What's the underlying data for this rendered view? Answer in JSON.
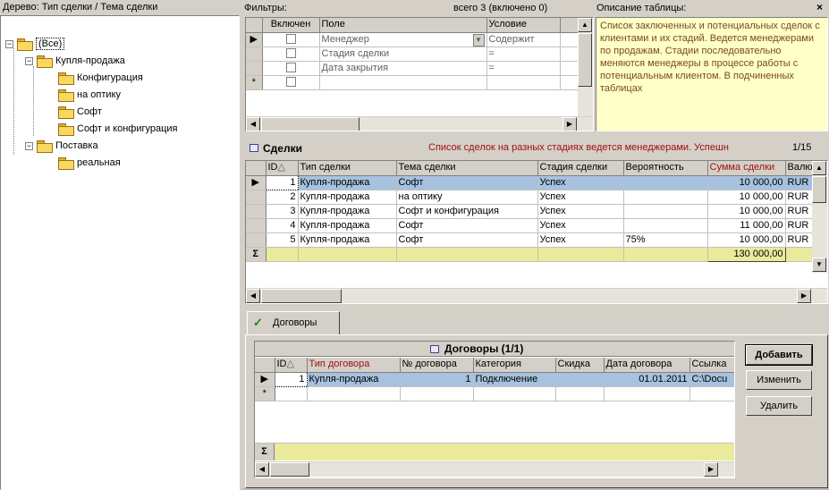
{
  "tree": {
    "title": "Дерево: Тип сделки / Тема сделки",
    "nodes": [
      {
        "label": "(Все)",
        "expander": "−"
      },
      {
        "label": "Купля-продажа",
        "expander": "−"
      },
      {
        "label": "Конфигурация"
      },
      {
        "label": "на оптику"
      },
      {
        "label": "Софт"
      },
      {
        "label": "Софт и конфигурация"
      },
      {
        "label": "Поставка",
        "expander": "−"
      },
      {
        "label": "реальная"
      }
    ]
  },
  "filters": {
    "title": "Фильтры:",
    "count": "всего 3 (включено 0)",
    "columns": [
      "Включен",
      "Поле",
      "Условие"
    ],
    "rows": [
      {
        "field": "Менеджер",
        "condition": "Содержит"
      },
      {
        "field": "Стадия сделки",
        "condition": "="
      },
      {
        "field": "Дата закрытия",
        "condition": "="
      }
    ],
    "new_row_marker": "*"
  },
  "description": {
    "title": "Описание таблицы:",
    "close": "×",
    "text": "Список заключенных и потенциальных сделок с клиентами и их стадий. Ведется менеджерами по продажам. Стадии последовательно меняются менеджеры в процессе работы с потенциальным клиентом. В подчиненных таблицах"
  },
  "deals": {
    "title": "Сделки",
    "banner": "Список сделок на разных стадиях ведется менеджерами. Успешн",
    "page": "1/15",
    "columns": [
      "ID",
      "Тип сделки",
      "Тема сделки",
      "Стадия сделки",
      "Вероятность",
      "Сумма сделки",
      "Валю"
    ],
    "sort_mark": "△",
    "rows": [
      {
        "id": "1",
        "type": "Купля-продажа",
        "topic": "Софт",
        "stage": "Успех",
        "prob": "",
        "sum": "10 000,00",
        "cur": "RUR"
      },
      {
        "id": "2",
        "type": "Купля-продажа",
        "topic": "на оптику",
        "stage": "Успех",
        "prob": "",
        "sum": "10 000,00",
        "cur": "RUR"
      },
      {
        "id": "3",
        "type": "Купля-продажа",
        "topic": "Софт и конфигурация",
        "stage": "Успех",
        "prob": "",
        "sum": "10 000,00",
        "cur": "RUR"
      },
      {
        "id": "4",
        "type": "Купля-продажа",
        "topic": "Софт",
        "stage": "Успех",
        "prob": "",
        "sum": "11 000,00",
        "cur": "RUR"
      },
      {
        "id": "5",
        "type": "Купля-продажа",
        "topic": "Софт",
        "stage": "Успех",
        "prob": "75%",
        "sum": "10 000,00",
        "cur": "RUR"
      }
    ],
    "sum_marker": "Σ",
    "total": "130 000,00"
  },
  "contracts_tab": {
    "label": "Договоры",
    "check": "✓"
  },
  "contracts": {
    "title": "Договоры (1/1)",
    "columns": [
      "ID",
      "Тип договора",
      "№ договора",
      "Категория",
      "Скидка",
      "Дата договора",
      "Ссылка"
    ],
    "sort_mark": "△",
    "rows": [
      {
        "id": "1",
        "type": "Купля-продажа",
        "number": "1",
        "category": "Подключение",
        "discount": "",
        "date": "01.01.2011",
        "link": "C:\\Docu"
      }
    ],
    "new_row_marker": "*",
    "sum_marker": "Σ"
  },
  "buttons": {
    "add": "Добавить",
    "edit": "Изменить",
    "delete": "Удалить"
  },
  "colors": {
    "panel": "#d4d0c8",
    "selection": "#a6c2de",
    "sum_row": "#eaea9c",
    "description_bg": "#ffffc8",
    "accent_red": "#a01010"
  }
}
